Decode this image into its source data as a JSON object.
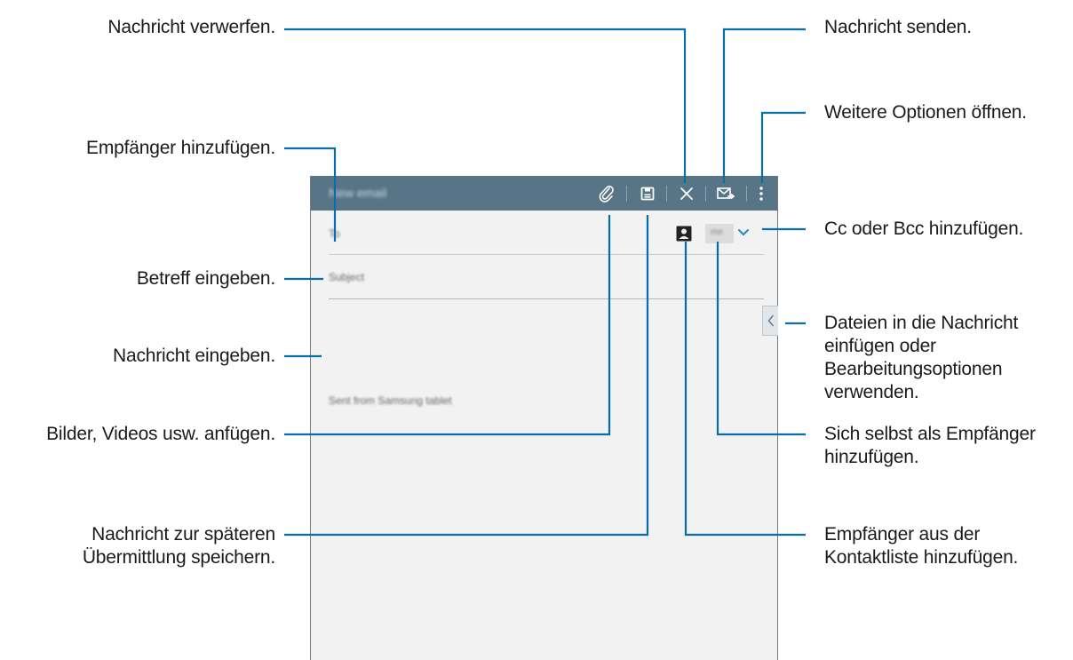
{
  "screen": {
    "title": "New email",
    "to_placeholder": "To",
    "me_label": "me",
    "subject_placeholder": "Subject",
    "signature": "Sent from Samsung tablet"
  },
  "icons": {
    "attach": "paperclip-icon",
    "save": "save-draft-icon",
    "discard": "close-icon",
    "send": "send-mail-icon",
    "more": "overflow-menu-icon",
    "contacts": "contact-card-icon",
    "expand": "chevron-down-icon",
    "side": "chevron-left-icon"
  },
  "colors": {
    "action_bar": "#587587",
    "leader_line": "#0a6ea6",
    "accent": "#1e88c8"
  },
  "callouts": {
    "discard": "Nachricht verwerfen.",
    "send": "Nachricht senden.",
    "more_options": "Weitere Optionen öffnen.",
    "add_recipients": "Empfänger hinzufügen.",
    "cc_bcc": "Cc oder Bcc hinzufügen.",
    "subject": "Betreff eingeben.",
    "insert_files": "Dateien in die Nachricht\neinfügen oder\nBearbeitungsoptionen\nverwenden.",
    "message": "Nachricht eingeben.",
    "attach": "Bilder, Videos usw. anfügen.",
    "add_self": "Sich selbst als Empfänger\nhinzufügen.",
    "save_later": "Nachricht zur späteren\nÜbermittlung speichern.",
    "contacts": "Empfänger aus der\nKontaktliste hinzufügen."
  }
}
